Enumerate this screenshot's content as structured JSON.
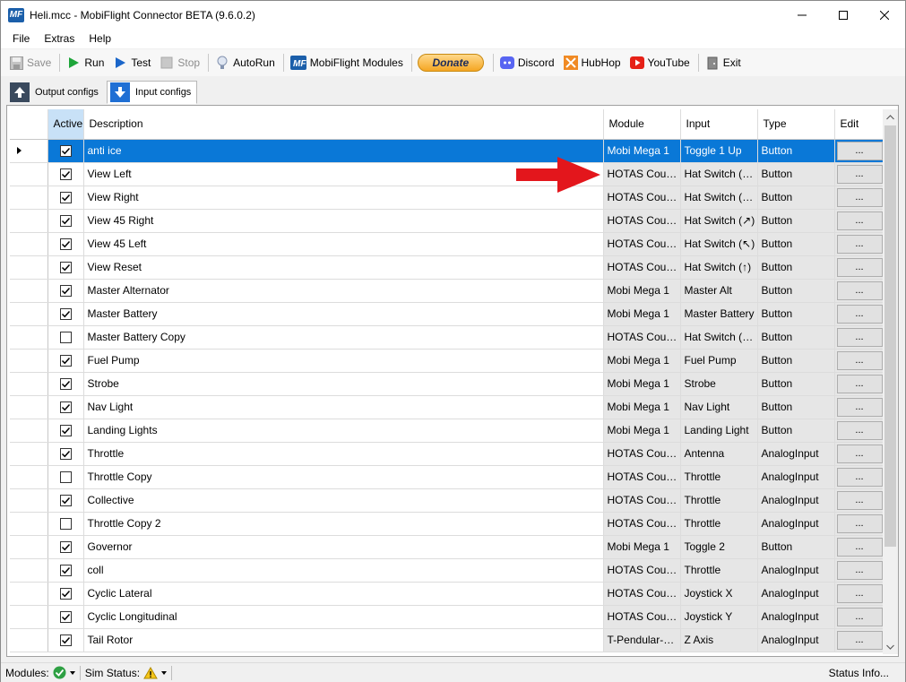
{
  "window": {
    "icon_text": "MF",
    "title": "Heli.mcc - MobiFlight Connector BETA (9.6.0.2)"
  },
  "menu": [
    "File",
    "Extras",
    "Help"
  ],
  "toolbar": {
    "save": "Save",
    "run": "Run",
    "test": "Test",
    "stop": "Stop",
    "autorun": "AutoRun",
    "modules": "MobiFlight Modules",
    "donate": "Donate",
    "discord": "Discord",
    "hubhop": "HubHop",
    "youtube": "YouTube",
    "exit": "Exit"
  },
  "tabs": {
    "output": "Output configs",
    "input": "Input configs",
    "active_tab": "Input configs"
  },
  "grid": {
    "headers": {
      "active": "Active",
      "description": "Description",
      "module": "Module",
      "input": "Input",
      "type": "Type",
      "edit": "Edit"
    },
    "edit_label": "...",
    "selected_row": 0,
    "rows": [
      {
        "active": true,
        "description": "anti ice",
        "module": "Mobi Mega 1",
        "input": "Toggle 1 Up",
        "type": "Button"
      },
      {
        "active": true,
        "description": "View Left",
        "module": "HOTAS Coug...",
        "input": "Hat Switch (⟵)",
        "type": "Button"
      },
      {
        "active": true,
        "description": "View Right",
        "module": "HOTAS Coug...",
        "input": "Hat Switch (⟶)",
        "type": "Button"
      },
      {
        "active": true,
        "description": "View 45 Right",
        "module": "HOTAS Coug...",
        "input": "Hat Switch (↗)",
        "type": "Button"
      },
      {
        "active": true,
        "description": "View 45 Left",
        "module": "HOTAS Coug...",
        "input": "Hat Switch (↖)",
        "type": "Button"
      },
      {
        "active": true,
        "description": "View Reset",
        "module": "HOTAS Coug...",
        "input": "Hat Switch (↑)",
        "type": "Button"
      },
      {
        "active": true,
        "description": "Master Alternator",
        "module": "Mobi Mega 1",
        "input": "Master Alt",
        "type": "Button"
      },
      {
        "active": true,
        "description": "Master Battery",
        "module": "Mobi Mega 1",
        "input": "Master Battery",
        "type": "Button"
      },
      {
        "active": false,
        "description": "Master Battery Copy",
        "module": "HOTAS Coug...",
        "input": "Hat Switch (⟵)",
        "type": "Button"
      },
      {
        "active": true,
        "description": "Fuel Pump",
        "module": "Mobi Mega 1",
        "input": "Fuel Pump",
        "type": "Button"
      },
      {
        "active": true,
        "description": "Strobe",
        "module": "Mobi Mega 1",
        "input": "Strobe",
        "type": "Button"
      },
      {
        "active": true,
        "description": "Nav Light",
        "module": "Mobi Mega 1",
        "input": "Nav Light",
        "type": "Button"
      },
      {
        "active": true,
        "description": "Landing Lights",
        "module": "Mobi Mega 1",
        "input": "Landing Light",
        "type": "Button"
      },
      {
        "active": true,
        "description": "Throttle",
        "module": "HOTAS Coug...",
        "input": "Antenna",
        "type": "AnalogInput"
      },
      {
        "active": false,
        "description": "Throttle Copy",
        "module": "HOTAS Coug...",
        "input": "Throttle",
        "type": "AnalogInput"
      },
      {
        "active": true,
        "description": "Collective",
        "module": "HOTAS Coug...",
        "input": "Throttle",
        "type": "AnalogInput"
      },
      {
        "active": false,
        "description": "Throttle Copy 2",
        "module": "HOTAS Coug...",
        "input": "Throttle",
        "type": "AnalogInput"
      },
      {
        "active": true,
        "description": "Governor",
        "module": "Mobi Mega 1",
        "input": "Toggle 2",
        "type": "Button"
      },
      {
        "active": true,
        "description": "coll",
        "module": "HOTAS Coug...",
        "input": "Throttle",
        "type": "AnalogInput"
      },
      {
        "active": true,
        "description": "Cyclic Lateral",
        "module": "HOTAS Coug...",
        "input": "Joystick X",
        "type": "AnalogInput"
      },
      {
        "active": true,
        "description": "Cyclic Longitudinal",
        "module": "HOTAS Coug...",
        "input": "Joystick Y",
        "type": "AnalogInput"
      },
      {
        "active": true,
        "description": "Tail Rotor",
        "module": "T-Pendular-Ru...",
        "input": "Z Axis",
        "type": "AnalogInput"
      }
    ]
  },
  "statusbar": {
    "modules": "Modules:",
    "sim_status": "Sim Status:",
    "status_info": "Status Info..."
  },
  "colors": {
    "selection": "#0a78d7",
    "active_header": "#c8e1f7",
    "annotation_arrow": "#e3161c"
  }
}
